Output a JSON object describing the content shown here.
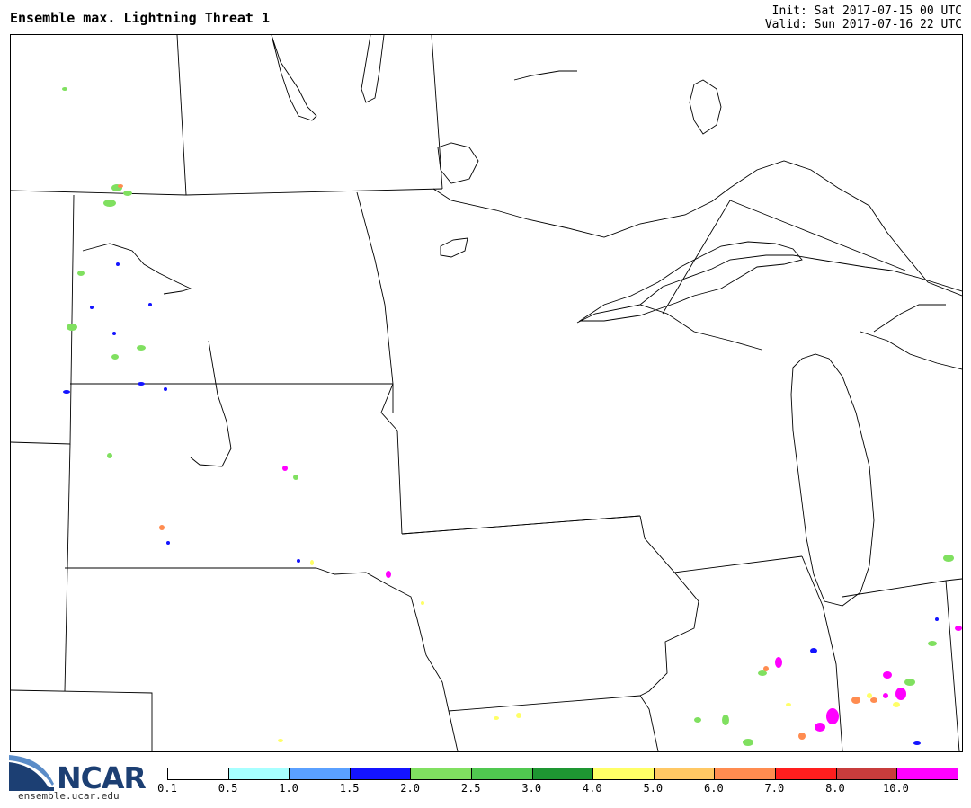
{
  "header": {
    "title": "Ensemble max. Lightning Threat 1",
    "init": "Init: Sat 2017-07-15 00 UTC",
    "valid": "Valid: Sun 2017-07-16 22 UTC"
  },
  "logo": {
    "name": "NCAR",
    "url": "ensemble.ucar.edu"
  },
  "colorbar": {
    "colors": [
      "#ffffff",
      "#a6ffff",
      "#5aa0ff",
      "#1414ff",
      "#80e060",
      "#50c850",
      "#1e9632",
      "#ffff66",
      "#ffc864",
      "#ff8c50",
      "#ff1e1e",
      "#c83c3c",
      "#ff00ff"
    ],
    "labels": [
      "0.1",
      "0.5",
      "1.0",
      "1.5",
      "2.0",
      "2.5",
      "3.0",
      "4.0",
      "5.0",
      "6.0",
      "7.0",
      "8.0",
      "10.0"
    ]
  }
}
